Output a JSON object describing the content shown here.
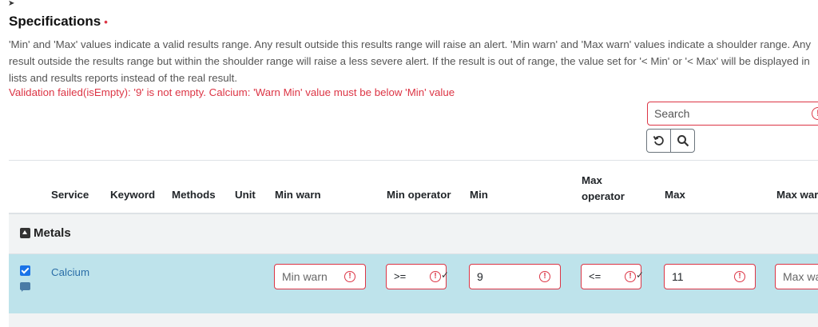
{
  "section": {
    "title": "Specifications",
    "required_marker": "•",
    "description": "'Min' and 'Max' values indicate a valid results range. Any result outside this results range will raise an alert. 'Min warn' and 'Max warn' values indicate a shoulder range. Any result outside the results range but within the shoulder range will raise a less severe alert. If the result is out of range, the value set for '< Min' or '< Max' will be displayed in lists and results reports instead of the real result.",
    "error": "Validation failed(isEmpty): '9' is not empty. Calcium: 'Warn Min' value must be below 'Min' value"
  },
  "search": {
    "placeholder": "Search",
    "value": ""
  },
  "columns": {
    "service": "Service",
    "keyword": "Keyword",
    "methods": "Methods",
    "unit": "Unit",
    "min_warn": "Min warn",
    "min_operator": "Min operator",
    "min": "Min",
    "max_operator_1": "Max",
    "max_operator_2": "operator",
    "max": "Max",
    "max_warn": "Max warn"
  },
  "category": {
    "label": "Metals"
  },
  "row": {
    "service": "Calcium",
    "checked": true,
    "min_warn": {
      "value": "",
      "placeholder": "Min warn"
    },
    "min_operator": ">=",
    "min": "9",
    "max_operator": "<=",
    "max": "11",
    "max_warn": {
      "value": "",
      "placeholder": "Max warn"
    }
  },
  "colors": {
    "error": "#dc3545",
    "link": "#2c6fa8",
    "row_selected": "#bee3eb",
    "category_bg": "#f1f3f4"
  }
}
